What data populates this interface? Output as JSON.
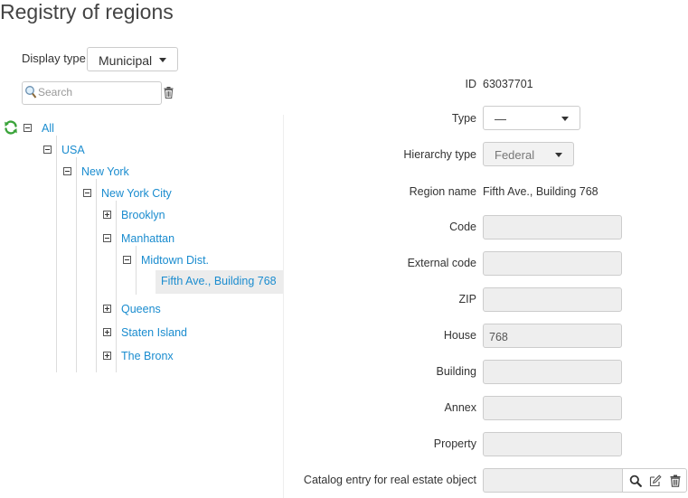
{
  "page": {
    "title": "Registry of regions"
  },
  "filter": {
    "display_type_label": "Display type",
    "display_type_value": "Municipal",
    "search_placeholder": "Search"
  },
  "tree": {
    "root": "All",
    "nodes": {
      "usa": "USA",
      "new_york": "New York",
      "new_york_city": "New York City",
      "brooklyn": "Brooklyn",
      "manhattan": "Manhattan",
      "midtown": "Midtown Dist.",
      "selected": "Fifth Ave., Building 768",
      "queens": "Queens",
      "staten_island": "Staten Island",
      "bronx": "The Bronx"
    }
  },
  "form": {
    "id_label": "ID",
    "id_value": "63037701",
    "type_label": "Type",
    "type_value": "—",
    "hierarchy_label": "Hierarchy type",
    "hierarchy_value": "Federal",
    "region_name_label": "Region name",
    "region_name_value": "Fifth Ave., Building 768",
    "code_label": "Code",
    "code_value": "",
    "external_code_label": "External code",
    "external_code_value": "",
    "zip_label": "ZIP",
    "zip_value": "",
    "house_label": "House",
    "house_value": "768",
    "building_label": "Building",
    "building_value": "",
    "annex_label": "Annex",
    "annex_value": "",
    "property_label": "Property",
    "property_value": "",
    "catalog_label": "Catalog entry for real estate object",
    "catalog_value": ""
  },
  "icons": {
    "accent": "#1a8ccf",
    "refresh_color": "#3aa33a"
  }
}
